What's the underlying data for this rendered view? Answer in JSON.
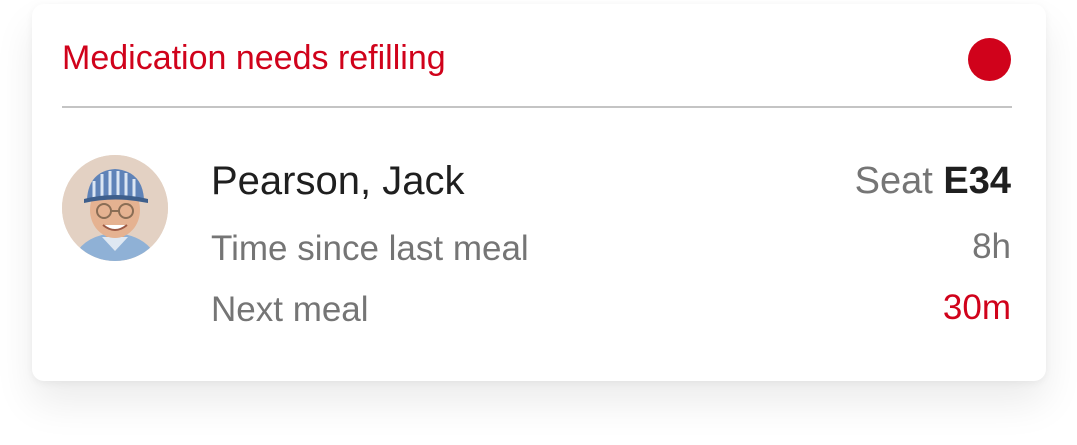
{
  "alert": {
    "title": "Medication needs refilling",
    "status_color": "#d0021b"
  },
  "passenger": {
    "name": "Pearson, Jack",
    "seat_prefix": "Seat",
    "seat_number": "E34",
    "avatar": "passenger-photo"
  },
  "details": {
    "last_meal_label": "Time since last meal",
    "last_meal_value": "8h",
    "next_meal_label": "Next meal",
    "next_meal_value": "30m"
  },
  "colors": {
    "accent": "#d0021b",
    "text_primary": "#1f1f1f",
    "text_secondary": "#757575",
    "divider": "#c4c4c4"
  }
}
